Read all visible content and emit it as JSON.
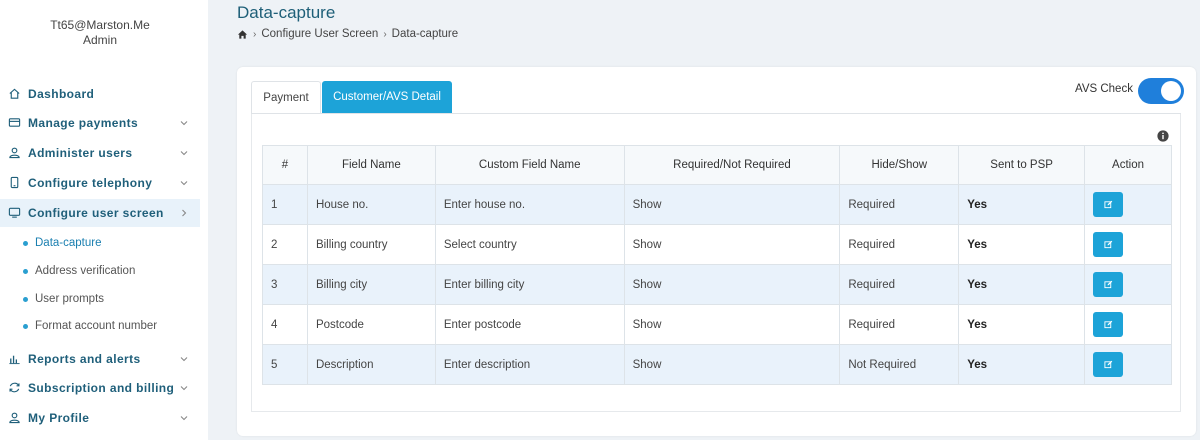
{
  "user": {
    "email": "Tt65@Marston.Me",
    "role": "Admin"
  },
  "nav": {
    "items": [
      {
        "label": "Dashboard",
        "icon": "home-icon"
      },
      {
        "label": "Manage payments",
        "icon": "card-icon"
      },
      {
        "label": "Administer users",
        "icon": "user-icon"
      },
      {
        "label": "Configure telephony",
        "icon": "phone-icon"
      },
      {
        "label": "Configure user screen",
        "icon": "monitor-icon"
      },
      {
        "label": "Reports and alerts",
        "icon": "bar-chart-icon"
      },
      {
        "label": "Subscription and billing",
        "icon": "refresh-icon"
      },
      {
        "label": "My Profile",
        "icon": "user-icon"
      }
    ],
    "sub_items": [
      "Data-capture",
      "Address verification",
      "User prompts",
      "Format account number"
    ]
  },
  "page": {
    "title": "Data-capture"
  },
  "breadcrumb": {
    "items": [
      "Configure User Screen",
      "Data-capture"
    ]
  },
  "tabs": [
    {
      "label": "Payment"
    },
    {
      "label": "Customer/AVS Detail"
    }
  ],
  "avs": {
    "label": "AVS Check",
    "enabled": true
  },
  "table": {
    "headers": [
      "#",
      "Field Name",
      "Custom Field Name",
      "Required/Not Required",
      "Hide/Show",
      "Sent to PSP",
      "Action"
    ],
    "rows": [
      {
        "num": "1",
        "field": "House no.",
        "custom": "Enter house no.",
        "req": "Show",
        "hide": "Required",
        "psp": "Yes"
      },
      {
        "num": "2",
        "field": "Billing country",
        "custom": "Select country",
        "req": "Show",
        "hide": "Required",
        "psp": "Yes"
      },
      {
        "num": "3",
        "field": "Billing city",
        "custom": "Enter billing city",
        "req": "Show",
        "hide": "Required",
        "psp": "Yes"
      },
      {
        "num": "4",
        "field": "Postcode",
        "custom": "Enter postcode",
        "req": "Show",
        "hide": "Required",
        "psp": "Yes"
      },
      {
        "num": "5",
        "field": "Description",
        "custom": "Enter description",
        "req": "Show",
        "hide": "Not Required",
        "psp": "Yes"
      }
    ]
  },
  "colors": {
    "accent": "#1da3d8",
    "nav_text": "#1f5f7a",
    "toggle": "#1f7fdb"
  }
}
